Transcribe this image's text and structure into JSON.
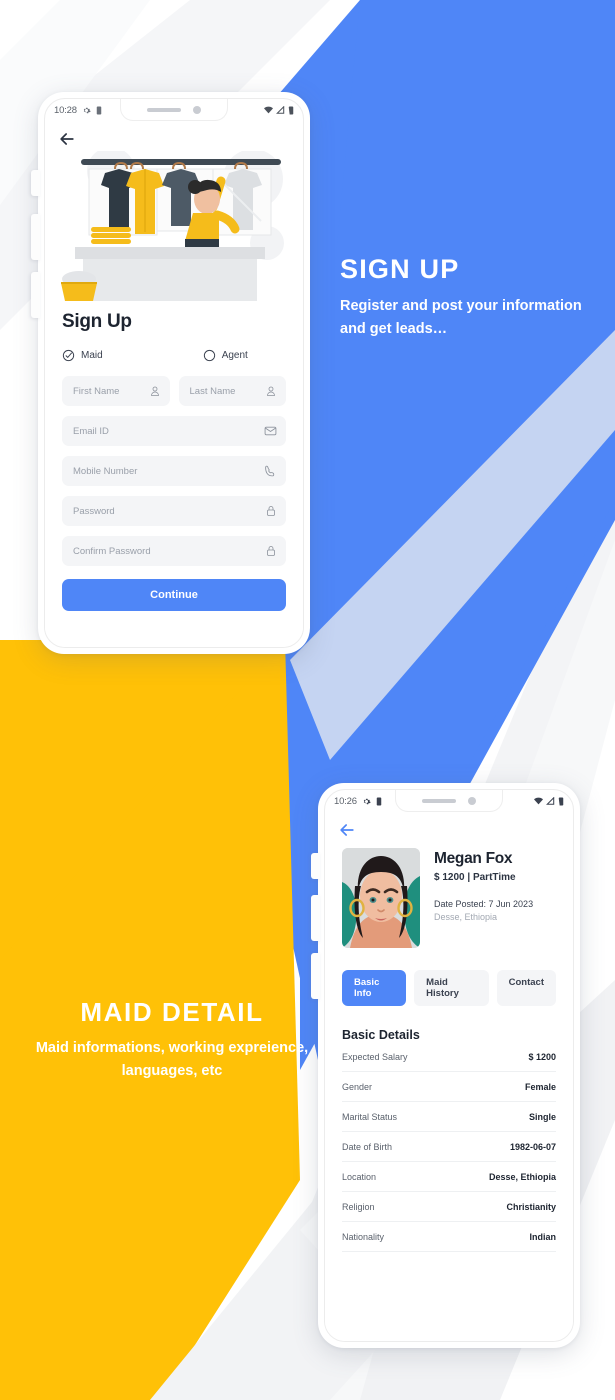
{
  "theme": {
    "blue": "#4F86F7",
    "yellow": "#FFC107",
    "light_gray": "#F4F5F7",
    "text_dark": "#1D2430"
  },
  "promos": {
    "signup": {
      "title": "SIGN UP",
      "subtitle": "Register and post your information and get leads…"
    },
    "maid": {
      "title": "MAID DETAIL",
      "subtitle": "Maid informations, working expreience, languages, etc"
    }
  },
  "phone1": {
    "status": {
      "time": "10:28",
      "left_icons": [
        "gear-icon",
        "battery-icon"
      ],
      "right_icons": [
        "wifi-icon",
        "signal-icon",
        "battery-icon"
      ]
    },
    "back_icon": "back-arrow-icon",
    "illustration": "laundry-clothing-rack-illustration",
    "title": "Sign Up",
    "roles": [
      {
        "label": "Maid",
        "selected": true,
        "icon": "check-circle-icon"
      },
      {
        "label": "Agent",
        "selected": false,
        "icon": "empty-circle-icon"
      }
    ],
    "fields": [
      {
        "placeholder": "First Name",
        "icon": "user-icon",
        "value": ""
      },
      {
        "placeholder": "Last Name",
        "icon": "user-icon",
        "value": ""
      },
      {
        "placeholder": "Email ID",
        "icon": "envelope-icon",
        "value": ""
      },
      {
        "placeholder": "Mobile Number",
        "icon": "phone-icon",
        "value": ""
      },
      {
        "placeholder": "Password",
        "icon": "lock-icon",
        "value": ""
      },
      {
        "placeholder": "Confirm Password",
        "icon": "lock-icon",
        "value": ""
      }
    ],
    "continue_label": "Continue"
  },
  "phone2": {
    "status": {
      "time": "10:26",
      "left_icons": [
        "gear-icon",
        "battery-icon"
      ],
      "right_icons": [
        "wifi-icon",
        "signal-icon",
        "battery-icon"
      ]
    },
    "back_icon": "back-arrow-icon",
    "avatar": "woman-portrait-avatar",
    "name": "Megan Fox",
    "salary_type": "$ 1200 | PartTime",
    "date_posted": "Date Posted: 7 Jun 2023",
    "location": "Desse, Ethiopia",
    "tabs": [
      {
        "label": "Basic Info",
        "active": true
      },
      {
        "label": "Maid History",
        "active": false
      },
      {
        "label": "Contact",
        "active": false
      }
    ],
    "section_title": "Basic Details",
    "details": [
      {
        "key": "Expected Salary",
        "value": "$ 1200"
      },
      {
        "key": "Gender",
        "value": "Female"
      },
      {
        "key": "Marital Status",
        "value": "Single"
      },
      {
        "key": "Date of Birth",
        "value": "1982-06-07"
      },
      {
        "key": "Location",
        "value": "Desse, Ethiopia"
      },
      {
        "key": "Religion",
        "value": "Christianity"
      },
      {
        "key": "Nationality",
        "value": "Indian"
      }
    ]
  }
}
